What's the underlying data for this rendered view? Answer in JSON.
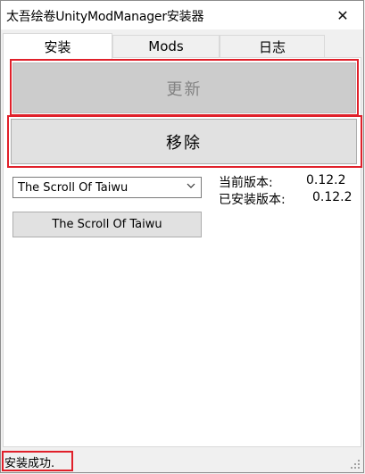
{
  "window": {
    "title": "太吾绘卷UnityModManager安装器",
    "close_glyph": "✕"
  },
  "tabs": [
    {
      "label": "安装",
      "active": true
    },
    {
      "label": "Mods",
      "active": false
    },
    {
      "label": "日志",
      "active": false
    }
  ],
  "install": {
    "update_label": "更新",
    "remove_label": "移除",
    "game_select_value": "The Scroll Of Taiwu",
    "game_button_label": "The Scroll Of Taiwu",
    "current_version_label": "当前版本:",
    "current_version_value": "0.12.2",
    "installed_version_label": "已安装版本:",
    "installed_version_value": "0.12.2"
  },
  "status_bar": {
    "text": "安装成功."
  },
  "colors": {
    "highlight": "#e0202a",
    "disabled_button": "#cccccc",
    "button": "#e1e1e1"
  }
}
